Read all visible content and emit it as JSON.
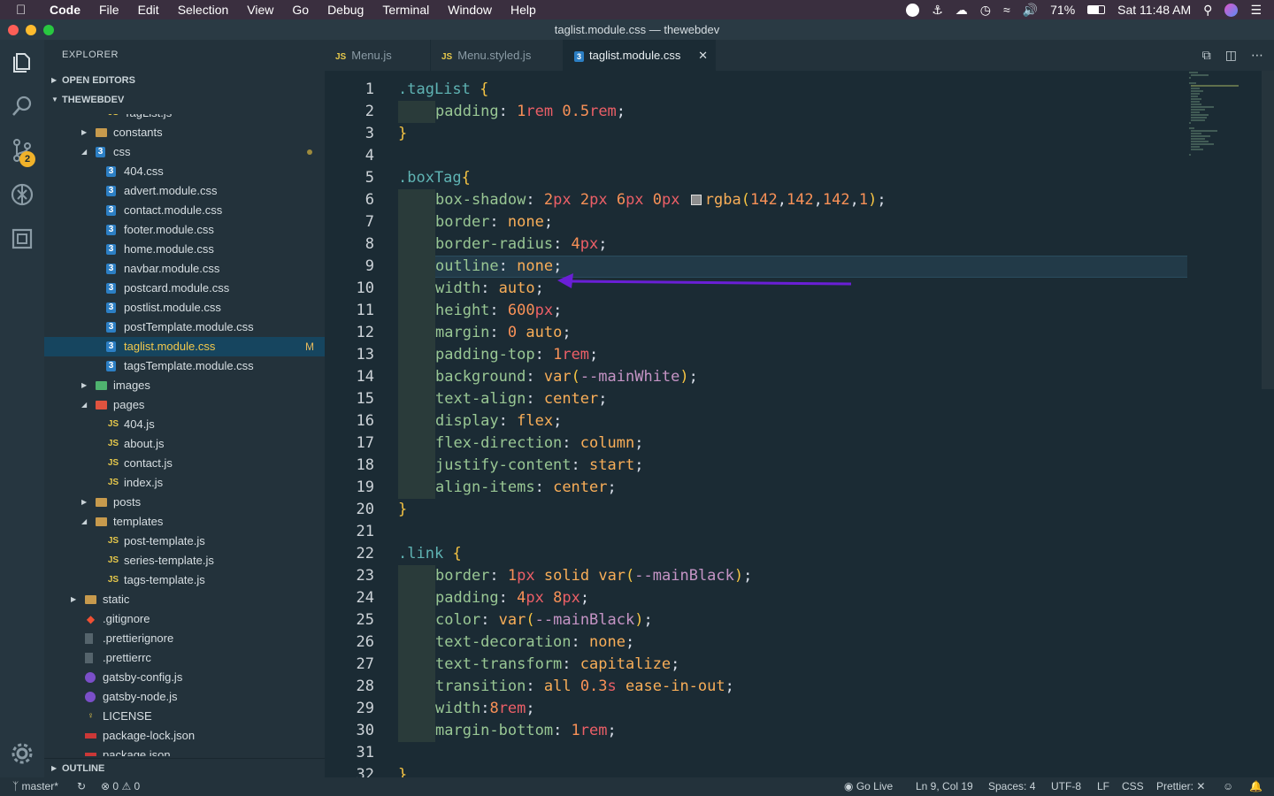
{
  "menubar": {
    "app": "Code",
    "items": [
      "File",
      "Edit",
      "Selection",
      "View",
      "Go",
      "Debug",
      "Terminal",
      "Window",
      "Help"
    ],
    "battery": "71%",
    "clock": "Sat 11:48 AM"
  },
  "window": {
    "title": "taglist.module.css — thewebdev"
  },
  "activity": {
    "scm_badge": "2"
  },
  "sidebar": {
    "title": "EXPLORER",
    "open_editors": "OPEN EDITORS",
    "project": "THEWEBDEV",
    "outline": "OUTLINE",
    "tree": [
      {
        "label": "TagList.js",
        "icon": "js",
        "depth": 3,
        "twisty": "none"
      },
      {
        "label": "constants",
        "icon": "folder",
        "depth": 2,
        "twisty": "closed"
      },
      {
        "label": "css",
        "icon": "folder-css",
        "depth": 2,
        "twisty": "open",
        "dot": true
      },
      {
        "label": "404.css",
        "icon": "css",
        "depth": 3,
        "twisty": "none"
      },
      {
        "label": "advert.module.css",
        "icon": "css",
        "depth": 3,
        "twisty": "none"
      },
      {
        "label": "contact.module.css",
        "icon": "css",
        "depth": 3,
        "twisty": "none"
      },
      {
        "label": "footer.module.css",
        "icon": "css",
        "depth": 3,
        "twisty": "none"
      },
      {
        "label": "home.module.css",
        "icon": "css",
        "depth": 3,
        "twisty": "none"
      },
      {
        "label": "navbar.module.css",
        "icon": "css",
        "depth": 3,
        "twisty": "none"
      },
      {
        "label": "postcard.module.css",
        "icon": "css",
        "depth": 3,
        "twisty": "none"
      },
      {
        "label": "postlist.module.css",
        "icon": "css",
        "depth": 3,
        "twisty": "none"
      },
      {
        "label": "postTemplate.module.css",
        "icon": "css",
        "depth": 3,
        "twisty": "none"
      },
      {
        "label": "taglist.module.css",
        "icon": "css",
        "depth": 3,
        "twisty": "none",
        "selected": true,
        "modified": "M"
      },
      {
        "label": "tagsTemplate.module.css",
        "icon": "css",
        "depth": 3,
        "twisty": "none"
      },
      {
        "label": "images",
        "icon": "folder-images",
        "depth": 2,
        "twisty": "closed"
      },
      {
        "label": "pages",
        "icon": "folder-pages",
        "depth": 2,
        "twisty": "open"
      },
      {
        "label": "404.js",
        "icon": "js",
        "depth": 3,
        "twisty": "none"
      },
      {
        "label": "about.js",
        "icon": "js",
        "depth": 3,
        "twisty": "none"
      },
      {
        "label": "contact.js",
        "icon": "js",
        "depth": 3,
        "twisty": "none"
      },
      {
        "label": "index.js",
        "icon": "js",
        "depth": 3,
        "twisty": "none"
      },
      {
        "label": "posts",
        "icon": "folder",
        "depth": 2,
        "twisty": "closed"
      },
      {
        "label": "templates",
        "icon": "folder-templates",
        "depth": 2,
        "twisty": "open"
      },
      {
        "label": "post-template.js",
        "icon": "js",
        "depth": 3,
        "twisty": "none"
      },
      {
        "label": "series-template.js",
        "icon": "js",
        "depth": 3,
        "twisty": "none"
      },
      {
        "label": "tags-template.js",
        "icon": "js",
        "depth": 3,
        "twisty": "none"
      },
      {
        "label": "static",
        "icon": "folder",
        "depth": 1,
        "twisty": "closed"
      },
      {
        "label": ".gitignore",
        "icon": "git",
        "depth": 1,
        "twisty": "none"
      },
      {
        "label": ".prettierignore",
        "icon": "file",
        "depth": 1,
        "twisty": "none"
      },
      {
        "label": ".prettierrc",
        "icon": "file",
        "depth": 1,
        "twisty": "none"
      },
      {
        "label": "gatsby-config.js",
        "icon": "gatsby",
        "depth": 1,
        "twisty": "none"
      },
      {
        "label": "gatsby-node.js",
        "icon": "gatsby",
        "depth": 1,
        "twisty": "none"
      },
      {
        "label": "LICENSE",
        "icon": "license",
        "depth": 1,
        "twisty": "none"
      },
      {
        "label": "package-lock.json",
        "icon": "npm",
        "depth": 1,
        "twisty": "none"
      },
      {
        "label": "package.json",
        "icon": "npm",
        "depth": 1,
        "twisty": "none"
      }
    ]
  },
  "tabs": [
    {
      "label": "Menu.js",
      "icon": "JS",
      "active": false
    },
    {
      "label": "Menu.styled.js",
      "icon": "JS",
      "active": false
    },
    {
      "label": "taglist.module.css",
      "icon": "css",
      "active": true
    }
  ],
  "editor": {
    "current_line": 9,
    "lines": [
      [
        [
          "sel",
          ".tagList"
        ],
        [
          "punc",
          " "
        ],
        [
          "brace",
          "{"
        ]
      ],
      [
        [
          "ind",
          ""
        ],
        [
          "prop",
          "padding"
        ],
        [
          "punc",
          ": "
        ],
        [
          "num",
          "1"
        ],
        [
          "unit",
          "rem"
        ],
        [
          "punc",
          " "
        ],
        [
          "num",
          "0.5"
        ],
        [
          "unit",
          "rem"
        ],
        [
          "punc",
          ";"
        ]
      ],
      [
        [
          "brace",
          "}"
        ]
      ],
      [],
      [
        [
          "sel",
          ".boxTag"
        ],
        [
          "brace",
          "{"
        ]
      ],
      [
        [
          "ind",
          ""
        ],
        [
          "prop",
          "box-shadow"
        ],
        [
          "punc",
          ": "
        ],
        [
          "num",
          "2"
        ],
        [
          "unit",
          "px"
        ],
        [
          "punc",
          " "
        ],
        [
          "num",
          "2"
        ],
        [
          "unit",
          "px"
        ],
        [
          "punc",
          " "
        ],
        [
          "num",
          "6"
        ],
        [
          "unit",
          "px"
        ],
        [
          "punc",
          " "
        ],
        [
          "num",
          "0"
        ],
        [
          "unit",
          "px"
        ],
        [
          "punc",
          " "
        ],
        [
          "swatch",
          ""
        ],
        [
          "fn",
          "rgba"
        ],
        [
          "brace",
          "("
        ],
        [
          "num",
          "142"
        ],
        [
          "punc",
          ","
        ],
        [
          "num",
          "142"
        ],
        [
          "punc",
          ","
        ],
        [
          "num",
          "142"
        ],
        [
          "punc",
          ","
        ],
        [
          "num",
          "1"
        ],
        [
          "brace",
          ")"
        ],
        [
          "punc",
          ";"
        ]
      ],
      [
        [
          "ind",
          ""
        ],
        [
          "prop",
          "border"
        ],
        [
          "punc",
          ": "
        ],
        [
          "val",
          "none"
        ],
        [
          "punc",
          ";"
        ]
      ],
      [
        [
          "ind",
          ""
        ],
        [
          "prop",
          "border-radius"
        ],
        [
          "punc",
          ": "
        ],
        [
          "num",
          "4"
        ],
        [
          "unit",
          "px"
        ],
        [
          "punc",
          ";"
        ]
      ],
      [
        [
          "ind",
          ""
        ],
        [
          "prop",
          "outline"
        ],
        [
          "punc",
          ": "
        ],
        [
          "val",
          "none"
        ],
        [
          "punc",
          ";"
        ]
      ],
      [
        [
          "ind",
          ""
        ],
        [
          "prop",
          "width"
        ],
        [
          "punc",
          ": "
        ],
        [
          "val",
          "auto"
        ],
        [
          "punc",
          ";"
        ]
      ],
      [
        [
          "ind",
          ""
        ],
        [
          "prop",
          "height"
        ],
        [
          "punc",
          ": "
        ],
        [
          "num",
          "600"
        ],
        [
          "unit",
          "px"
        ],
        [
          "punc",
          ";"
        ]
      ],
      [
        [
          "ind",
          ""
        ],
        [
          "prop",
          "margin"
        ],
        [
          "punc",
          ": "
        ],
        [
          "num",
          "0"
        ],
        [
          "punc",
          " "
        ],
        [
          "val",
          "auto"
        ],
        [
          "punc",
          ";"
        ]
      ],
      [
        [
          "ind",
          ""
        ],
        [
          "prop",
          "padding-top"
        ],
        [
          "punc",
          ": "
        ],
        [
          "num",
          "1"
        ],
        [
          "unit",
          "rem"
        ],
        [
          "punc",
          ";"
        ]
      ],
      [
        [
          "ind",
          ""
        ],
        [
          "prop",
          "background"
        ],
        [
          "punc",
          ": "
        ],
        [
          "fn",
          "var"
        ],
        [
          "brace",
          "("
        ],
        [
          "var",
          "--mainWhite"
        ],
        [
          "brace",
          ")"
        ],
        [
          "punc",
          ";"
        ]
      ],
      [
        [
          "ind",
          ""
        ],
        [
          "prop",
          "text-align"
        ],
        [
          "punc",
          ": "
        ],
        [
          "val",
          "center"
        ],
        [
          "punc",
          ";"
        ]
      ],
      [
        [
          "ind",
          ""
        ],
        [
          "prop",
          "display"
        ],
        [
          "punc",
          ": "
        ],
        [
          "val",
          "flex"
        ],
        [
          "punc",
          ";"
        ]
      ],
      [
        [
          "ind",
          ""
        ],
        [
          "prop",
          "flex-direction"
        ],
        [
          "punc",
          ": "
        ],
        [
          "val",
          "column"
        ],
        [
          "punc",
          ";"
        ]
      ],
      [
        [
          "ind",
          ""
        ],
        [
          "prop",
          "justify-content"
        ],
        [
          "punc",
          ": "
        ],
        [
          "val",
          "start"
        ],
        [
          "punc",
          ";"
        ]
      ],
      [
        [
          "ind",
          ""
        ],
        [
          "prop",
          "align-items"
        ],
        [
          "punc",
          ": "
        ],
        [
          "val",
          "center"
        ],
        [
          "punc",
          ";"
        ]
      ],
      [
        [
          "brace",
          "}"
        ]
      ],
      [],
      [
        [
          "sel",
          ".link"
        ],
        [
          "punc",
          " "
        ],
        [
          "brace",
          "{"
        ]
      ],
      [
        [
          "ind",
          ""
        ],
        [
          "prop",
          "border"
        ],
        [
          "punc",
          ": "
        ],
        [
          "num",
          "1"
        ],
        [
          "unit",
          "px"
        ],
        [
          "punc",
          " "
        ],
        [
          "val",
          "solid"
        ],
        [
          "punc",
          " "
        ],
        [
          "fn",
          "var"
        ],
        [
          "brace",
          "("
        ],
        [
          "var",
          "--mainBlack"
        ],
        [
          "brace",
          ")"
        ],
        [
          "punc",
          ";"
        ]
      ],
      [
        [
          "ind",
          ""
        ],
        [
          "prop",
          "padding"
        ],
        [
          "punc",
          ": "
        ],
        [
          "num",
          "4"
        ],
        [
          "unit",
          "px"
        ],
        [
          "punc",
          " "
        ],
        [
          "num",
          "8"
        ],
        [
          "unit",
          "px"
        ],
        [
          "punc",
          ";"
        ]
      ],
      [
        [
          "ind",
          ""
        ],
        [
          "prop",
          "color"
        ],
        [
          "punc",
          ": "
        ],
        [
          "fn",
          "var"
        ],
        [
          "brace",
          "("
        ],
        [
          "var",
          "--mainBlack"
        ],
        [
          "brace",
          ")"
        ],
        [
          "punc",
          ";"
        ]
      ],
      [
        [
          "ind",
          ""
        ],
        [
          "prop",
          "text-decoration"
        ],
        [
          "punc",
          ": "
        ],
        [
          "val",
          "none"
        ],
        [
          "punc",
          ";"
        ]
      ],
      [
        [
          "ind",
          ""
        ],
        [
          "prop",
          "text-transform"
        ],
        [
          "punc",
          ": "
        ],
        [
          "val",
          "capitalize"
        ],
        [
          "punc",
          ";"
        ]
      ],
      [
        [
          "ind",
          ""
        ],
        [
          "prop",
          "transition"
        ],
        [
          "punc",
          ": "
        ],
        [
          "val",
          "all"
        ],
        [
          "punc",
          " "
        ],
        [
          "num",
          "0.3"
        ],
        [
          "unit",
          "s"
        ],
        [
          "punc",
          " "
        ],
        [
          "val",
          "ease-in-out"
        ],
        [
          "punc",
          ";"
        ]
      ],
      [
        [
          "ind",
          ""
        ],
        [
          "prop",
          "width"
        ],
        [
          "punc",
          ":"
        ],
        [
          "num",
          "8"
        ],
        [
          "unit",
          "rem"
        ],
        [
          "punc",
          ";"
        ]
      ],
      [
        [
          "ind",
          ""
        ],
        [
          "prop",
          "margin-bottom"
        ],
        [
          "punc",
          ": "
        ],
        [
          "num",
          "1"
        ],
        [
          "unit",
          "rem"
        ],
        [
          "punc",
          ";"
        ]
      ],
      [],
      [
        [
          "brace",
          "}"
        ]
      ]
    ]
  },
  "status": {
    "branch": "master*",
    "errors": "0",
    "warnings": "0",
    "golive": "Go Live",
    "position": "Ln 9, Col 19",
    "spaces": "Spaces: 4",
    "encoding": "UTF-8",
    "eol": "LF",
    "language": "CSS",
    "prettier": "Prettier:"
  },
  "colors": {
    "accent_arrow": "#6a1fd6",
    "editor_bg": "#1b2b34",
    "sidebar_bg": "#23323b"
  }
}
